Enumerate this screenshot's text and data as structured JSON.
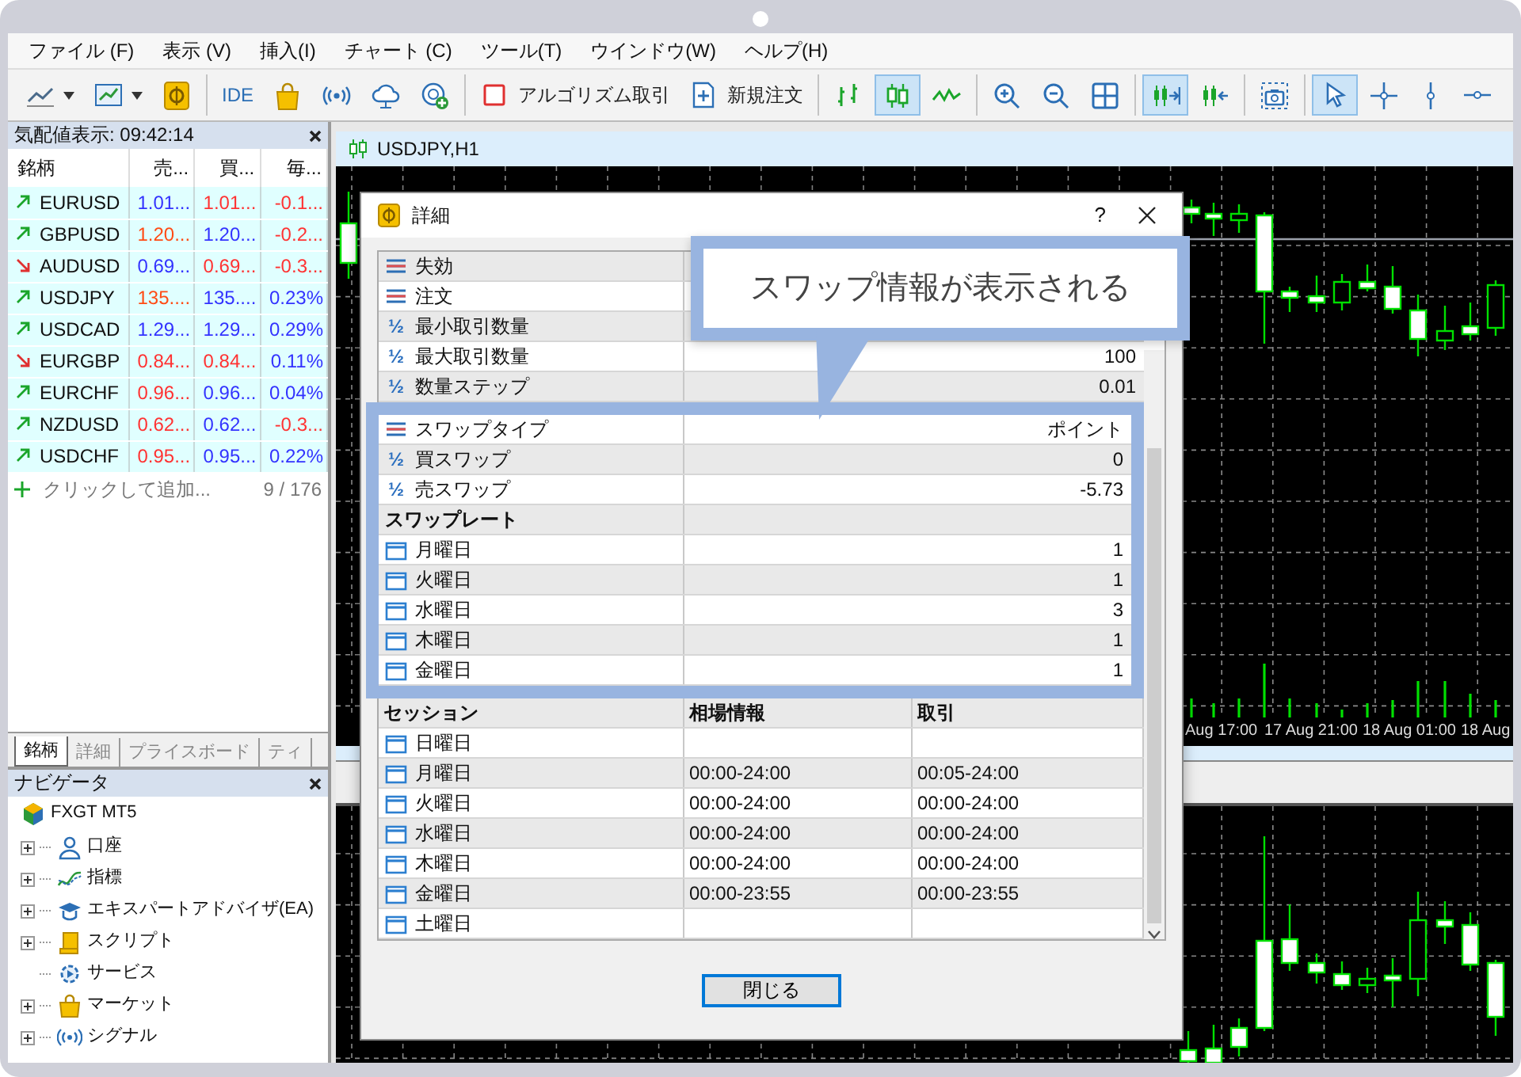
{
  "menu": [
    "ファイル (F)",
    "表示 (V)",
    "挿入(I)",
    "チャート (C)",
    "ツール(T)",
    "ウインドウ(W)",
    "ヘルプ(H)"
  ],
  "toolbar": [
    [
      {
        "kind": "linechart",
        "pressed": false,
        "dropdown": true
      },
      {
        "kind": "chartwindow",
        "pressed": false,
        "dropdown": true
      },
      {
        "kind": "coin",
        "pressed": false
      }
    ],
    [
      {
        "kind": "ide",
        "label": "IDE",
        "pressed": false
      },
      {
        "kind": "bag",
        "pressed": false
      },
      {
        "kind": "signal",
        "pressed": false
      },
      {
        "kind": "cloud",
        "pressed": false
      },
      {
        "kind": "globeadd",
        "pressed": false
      }
    ],
    [
      {
        "kind": "algo",
        "label": "アルゴリズム取引",
        "pressed": false
      },
      {
        "kind": "neworder",
        "label": "新規注文",
        "pressed": false
      }
    ],
    [
      {
        "kind": "bars",
        "pressed": false
      },
      {
        "kind": "candles",
        "pressed": true
      },
      {
        "kind": "line",
        "pressed": false
      }
    ],
    [
      {
        "kind": "zoomin",
        "pressed": false
      },
      {
        "kind": "zoomout",
        "pressed": false
      },
      {
        "kind": "tile",
        "pressed": false
      }
    ],
    [
      {
        "kind": "autoscroll",
        "pressed": true
      },
      {
        "kind": "shift",
        "pressed": false
      }
    ],
    [
      {
        "kind": "screenshot",
        "pressed": false
      }
    ],
    [
      {
        "kind": "cursor",
        "pressed": true
      },
      {
        "kind": "crosshair",
        "pressed": false
      },
      {
        "kind": "vline",
        "pressed": false
      },
      {
        "kind": "hline",
        "pressed": false
      }
    ]
  ],
  "market_watch": {
    "title": "気配値表示: 09:42:14",
    "columns": [
      "銘柄",
      "売...",
      "買...",
      "毎..."
    ],
    "rows": [
      {
        "rising": true,
        "symbol": "EURUSD",
        "bid": {
          "text": "1.01...",
          "color": "#3232ff"
        },
        "ask": {
          "text": "1.01...",
          "color": "#ff3232"
        },
        "change": {
          "text": "-0.1...",
          "color": "#ff3232"
        }
      },
      {
        "rising": true,
        "symbol": "GBPUSD",
        "bid": {
          "text": "1.20...",
          "color": "#ff4b14"
        },
        "ask": {
          "text": "1.20...",
          "color": "#3232ff"
        },
        "change": {
          "text": "-0.2...",
          "color": "#ff3232"
        }
      },
      {
        "rising": false,
        "symbol": "AUDUSD",
        "bid": {
          "text": "0.69...",
          "color": "#3232ff"
        },
        "ask": {
          "text": "0.69...",
          "color": "#ff3232"
        },
        "change": {
          "text": "-0.3...",
          "color": "#ff3232"
        }
      },
      {
        "rising": true,
        "symbol": "USDJPY",
        "bid": {
          "text": "135....",
          "color": "#ff4b14"
        },
        "ask": {
          "text": "135....",
          "color": "#3232ff"
        },
        "change": {
          "text": "0.23%",
          "color": "#3232ff"
        }
      },
      {
        "rising": true,
        "symbol": "USDCAD",
        "bid": {
          "text": "1.29...",
          "color": "#3232ff"
        },
        "ask": {
          "text": "1.29...",
          "color": "#3232ff"
        },
        "change": {
          "text": "0.29%",
          "color": "#3232ff"
        }
      },
      {
        "rising": false,
        "symbol": "EURGBP",
        "bid": {
          "text": "0.84...",
          "color": "#ff3232"
        },
        "ask": {
          "text": "0.84...",
          "color": "#ff3232"
        },
        "change": {
          "text": "0.11%",
          "color": "#3232ff"
        }
      },
      {
        "rising": true,
        "symbol": "EURCHF",
        "bid": {
          "text": "0.96...",
          "color": "#ff3232"
        },
        "ask": {
          "text": "0.96...",
          "color": "#3232ff"
        },
        "change": {
          "text": "0.04%",
          "color": "#3232ff"
        }
      },
      {
        "rising": true,
        "symbol": "NZDUSD",
        "bid": {
          "text": "0.62...",
          "color": "#ff3232"
        },
        "ask": {
          "text": "0.62...",
          "color": "#3232ff"
        },
        "change": {
          "text": "-0.3...",
          "color": "#ff3232"
        }
      },
      {
        "rising": true,
        "symbol": "USDCHF",
        "bid": {
          "text": "0.95...",
          "color": "#ff3232"
        },
        "ask": {
          "text": "0.95...",
          "color": "#3232ff"
        },
        "change": {
          "text": "0.22%",
          "color": "#3232ff"
        }
      }
    ],
    "add_label": "クリックして追加...",
    "count": "9 / 176",
    "tabs": [
      {
        "label": "銘柄",
        "selected": true
      },
      {
        "label": "詳細",
        "selected": false
      },
      {
        "label": "プライスボード",
        "selected": false
      },
      {
        "label": "ティ",
        "selected": false
      }
    ]
  },
  "navigator": {
    "title": "ナビゲータ",
    "root": {
      "label": "FXGT MT5",
      "children": [
        {
          "label": "口座",
          "kind": "account",
          "expandable": true
        },
        {
          "label": "指標",
          "kind": "indicator",
          "expandable": true
        },
        {
          "label": "エキスパートアドバイザ(EA)",
          "kind": "expert",
          "expandable": true
        },
        {
          "label": "スクリプト",
          "kind": "script",
          "expandable": true
        },
        {
          "label": "サービス",
          "kind": "service",
          "expandable": false
        },
        {
          "label": "マーケット",
          "kind": "market",
          "expandable": true
        },
        {
          "label": "シグナル",
          "kind": "signal",
          "expandable": true
        }
      ]
    }
  },
  "chart": {
    "title": "USDJPY,H1",
    "time_labels": [
      "Aug 17:00",
      "17 Aug 21:00",
      "18 Aug 01:00",
      "18 Aug"
    ]
  },
  "dialog": {
    "title": "詳細",
    "help": "?",
    "rows": [
      {
        "kind": "text",
        "label": "失効"
      },
      {
        "kind": "text",
        "label": "注文"
      },
      {
        "kind": "number",
        "symbol": "½",
        "label": "最小取引数量"
      },
      {
        "kind": "number",
        "symbol": "½",
        "label": "最大取引数量",
        "value": "100"
      },
      {
        "kind": "number",
        "symbol": "½",
        "label": "数量ステップ",
        "value": "0.01"
      }
    ],
    "swap_rows": [
      {
        "kind": "text",
        "label": "スワップタイプ",
        "value": "ポイント"
      },
      {
        "kind": "number",
        "symbol": "½",
        "label": "買スワップ",
        "value": "0"
      },
      {
        "kind": "number",
        "symbol": "½",
        "label": "売スワップ",
        "value": "-5.73"
      },
      {
        "kind": "heading",
        "label": "スワップレート"
      },
      {
        "kind": "day",
        "label": "月曜日",
        "value": "1"
      },
      {
        "kind": "day",
        "label": "火曜日",
        "value": "1"
      },
      {
        "kind": "day",
        "label": "水曜日",
        "value": "3"
      },
      {
        "kind": "day",
        "label": "木曜日",
        "value": "1"
      },
      {
        "kind": "day",
        "label": "金曜日",
        "value": "1"
      }
    ],
    "session_header": [
      "セッション",
      "相場情報",
      "取引"
    ],
    "sessions": [
      {
        "day": "日曜日"
      },
      {
        "day": "月曜日",
        "quotes": "00:00-24:00",
        "trade": "00:05-24:00"
      },
      {
        "day": "火曜日",
        "quotes": "00:00-24:00",
        "trade": "00:00-24:00"
      },
      {
        "day": "水曜日",
        "quotes": "00:00-24:00",
        "trade": "00:00-24:00"
      },
      {
        "day": "木曜日",
        "quotes": "00:00-24:00",
        "trade": "00:00-24:00"
      },
      {
        "day": "金曜日",
        "quotes": "00:00-23:55",
        "trade": "00:00-23:55"
      },
      {
        "day": "土曜日"
      }
    ],
    "button": "閉じる"
  },
  "callout": {
    "text": "スワップ情報が表示される"
  }
}
